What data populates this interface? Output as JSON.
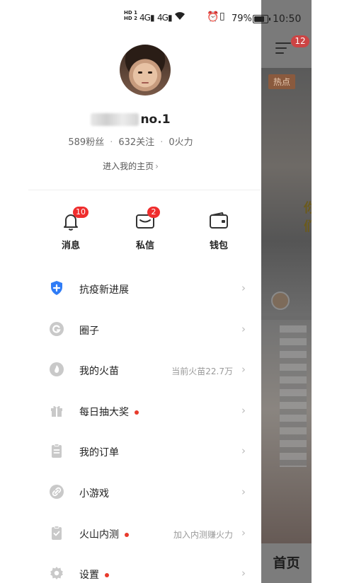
{
  "status_bar": {
    "hd1": "HD 1",
    "hd2": "HD 2",
    "signal1": "4G",
    "signal2": "4G",
    "battery_percent": "79%",
    "battery_level": 0.79,
    "time": "10:50"
  },
  "profile": {
    "username": "no.1",
    "fans": "589粉丝",
    "following": "632关注",
    "fire": "0火力",
    "homepage_link": "进入我的主页"
  },
  "quick_actions": [
    {
      "label": "消息",
      "icon": "bell-icon",
      "badge": "10"
    },
    {
      "label": "私信",
      "icon": "envelope-icon",
      "badge": "2"
    },
    {
      "label": "钱包",
      "icon": "wallet-icon",
      "badge": ""
    }
  ],
  "menu": [
    {
      "label": "抗疫新进展",
      "icon": "shield-plus-icon",
      "hint": "",
      "dot": false
    },
    {
      "label": "圈子",
      "icon": "circle-icon",
      "hint": "",
      "dot": false
    },
    {
      "label": "我的火苗",
      "icon": "flame-icon",
      "hint": "当前火苗22.7万",
      "dot": false
    },
    {
      "label": "每日抽大奖",
      "icon": "gift-icon",
      "hint": "",
      "dot": true
    },
    {
      "label": "我的订单",
      "icon": "clipboard-icon",
      "hint": "",
      "dot": false
    },
    {
      "label": "小游戏",
      "icon": "game-link-icon",
      "hint": "",
      "dot": false
    },
    {
      "label": "火山内测",
      "icon": "beta-test-icon",
      "hint": "加入内测赚火力",
      "dot": true
    },
    {
      "label": "设置",
      "icon": "gear-icon",
      "hint": "",
      "dot": true
    }
  ],
  "background_app": {
    "menu_badge": "12",
    "hot_tag": "热点",
    "home_tab": "首页",
    "overlay_text": "你们"
  },
  "colors": {
    "badge_red": "#ef2d2d",
    "dim_overlay": "#6b6b6b",
    "accent_blue": "#2f7cf6"
  }
}
